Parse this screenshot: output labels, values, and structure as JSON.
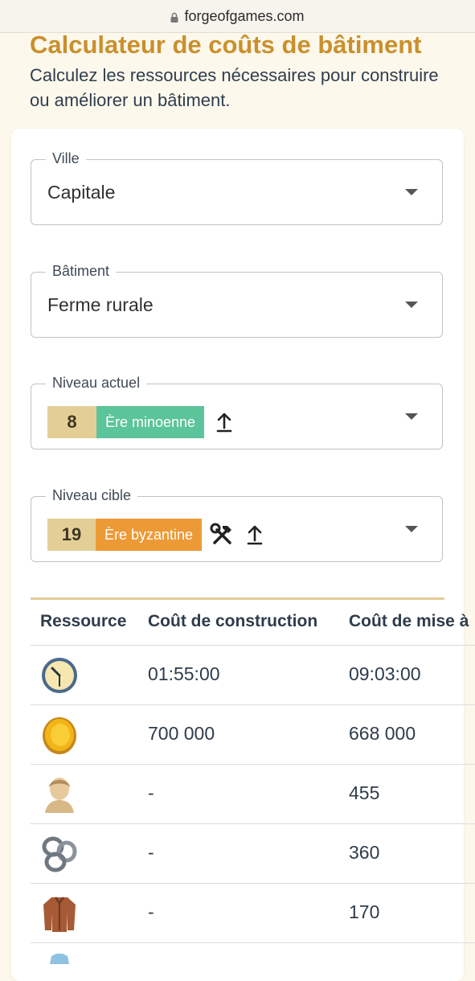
{
  "browser": {
    "url": "forgeofgames.com"
  },
  "header": {
    "title": "Calculateur de coûts de bâtiment",
    "subtitle": "Calculez les ressources nécessaires pour construire ou améliorer un bâtiment."
  },
  "form": {
    "city": {
      "label": "Ville",
      "value": "Capitale"
    },
    "building": {
      "label": "Bâtiment",
      "value": "Ferme rurale"
    },
    "current_level": {
      "label": "Niveau actuel",
      "level": "8",
      "era": "Ère minoenne",
      "era_color": "#5bc49a"
    },
    "target_level": {
      "label": "Niveau cible",
      "level": "19",
      "era": "Ère byzantine",
      "era_color": "#ec9a36"
    }
  },
  "table": {
    "headers": [
      "Ressource",
      "Coût de construction",
      "Coût de mise à"
    ],
    "rows": [
      {
        "icon": "clock-icon",
        "build": "01:55:00",
        "upgrade": "09:03:00"
      },
      {
        "icon": "coin-icon",
        "build": "700 000",
        "upgrade": "668 000"
      },
      {
        "icon": "bust-icon",
        "build": "-",
        "upgrade": "455"
      },
      {
        "icon": "chain-icon",
        "build": "-",
        "upgrade": "360"
      },
      {
        "icon": "jacket-icon",
        "build": "-",
        "upgrade": "170"
      }
    ]
  },
  "colors": {
    "accent": "#c9902d",
    "text": "#2f3e4e",
    "background": "#fdf8ec"
  }
}
